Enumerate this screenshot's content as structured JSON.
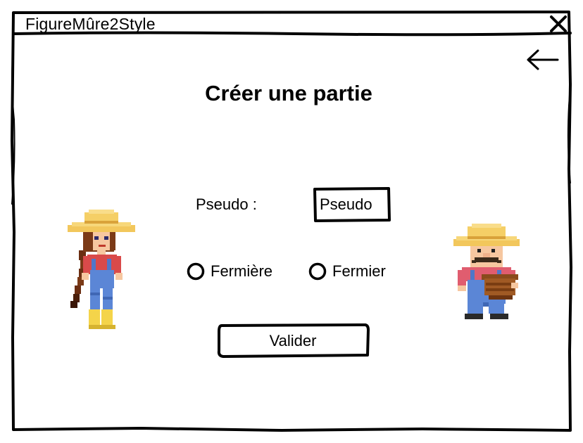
{
  "window": {
    "title": "FigureMûre2Style",
    "close_icon": "close-icon"
  },
  "nav": {
    "back_icon": "arrow-left-icon"
  },
  "page": {
    "title": "Créer une partie"
  },
  "form": {
    "pseudo_label": "Pseudo :",
    "pseudo_placeholder": "Pseudo",
    "pseudo_value": "",
    "roles": [
      {
        "label": "Fermière",
        "selected": false
      },
      {
        "label": "Fermier",
        "selected": false
      }
    ],
    "submit_label": "Valider"
  },
  "illustrations": {
    "left": "farmer-woman-sprite",
    "right": "farmer-man-sprite"
  },
  "colors": {
    "ink": "#000000",
    "background": "#ffffff"
  }
}
